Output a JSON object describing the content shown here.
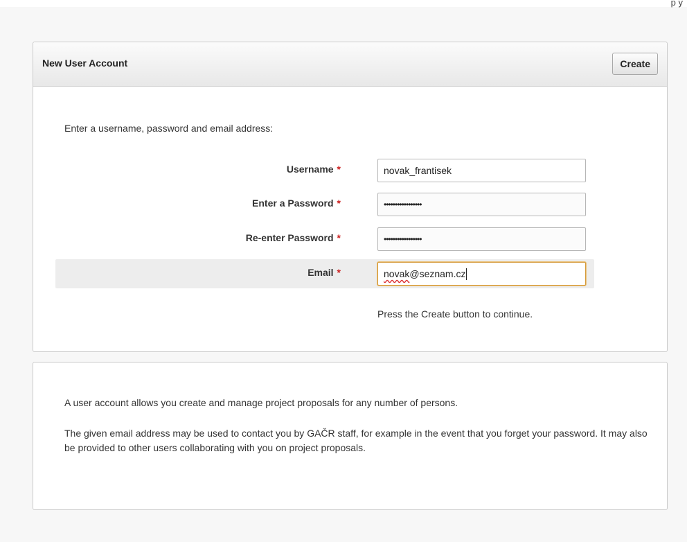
{
  "top_fragment": "p        y",
  "form": {
    "title": "New User Account",
    "create_label": "Create",
    "intro": "Enter a username, password and email address:",
    "required_marker": "*",
    "fields": {
      "username": {
        "label": "Username",
        "value": "novak_frantisek"
      },
      "password": {
        "label": "Enter a Password",
        "value": "•••••••••••••••••"
      },
      "password_confirm": {
        "label": "Re-enter Password",
        "value": "•••••••••••••••••"
      },
      "email": {
        "label": "Email",
        "value_user": "novak",
        "value_rest": "@seznam.cz"
      }
    },
    "hint": "Press the Create button to continue."
  },
  "info": {
    "p1": "A user account allows you create and manage project proposals for any number of persons.",
    "p2": "The given email address may be used to contact you by GAČR staff, for example in the event that you forget your password. It may also be provided to other users collaborating with you on project proposals."
  },
  "colors": {
    "required": "#cc2222",
    "focus_border": "#d59a3a",
    "highlight_row": "#ededed"
  }
}
